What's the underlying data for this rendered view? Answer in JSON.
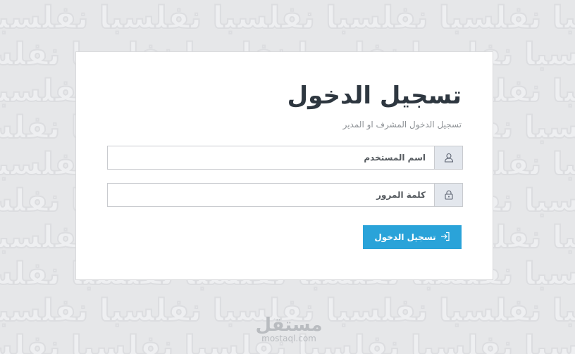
{
  "login": {
    "title": "تسجيل الدخول",
    "subtitle": "تسجيل الدخول المشرف او المدير",
    "username_placeholder": "اسم المستخدم",
    "username_value": "",
    "password_placeholder": "كلمة المرور",
    "password_value": "",
    "submit_label": "تسجيل الدخول",
    "icons": {
      "username": "user-icon",
      "password": "lock-icon",
      "submit": "sign-in-icon"
    }
  },
  "colors": {
    "background": "#e6e7e9",
    "card": "#ffffff",
    "addon": "#e3e7ed",
    "accent": "#2aa3d9",
    "title": "#2e3740"
  },
  "watermark": {
    "logo_text": "مستقل",
    "url": "mostaql.com"
  }
}
